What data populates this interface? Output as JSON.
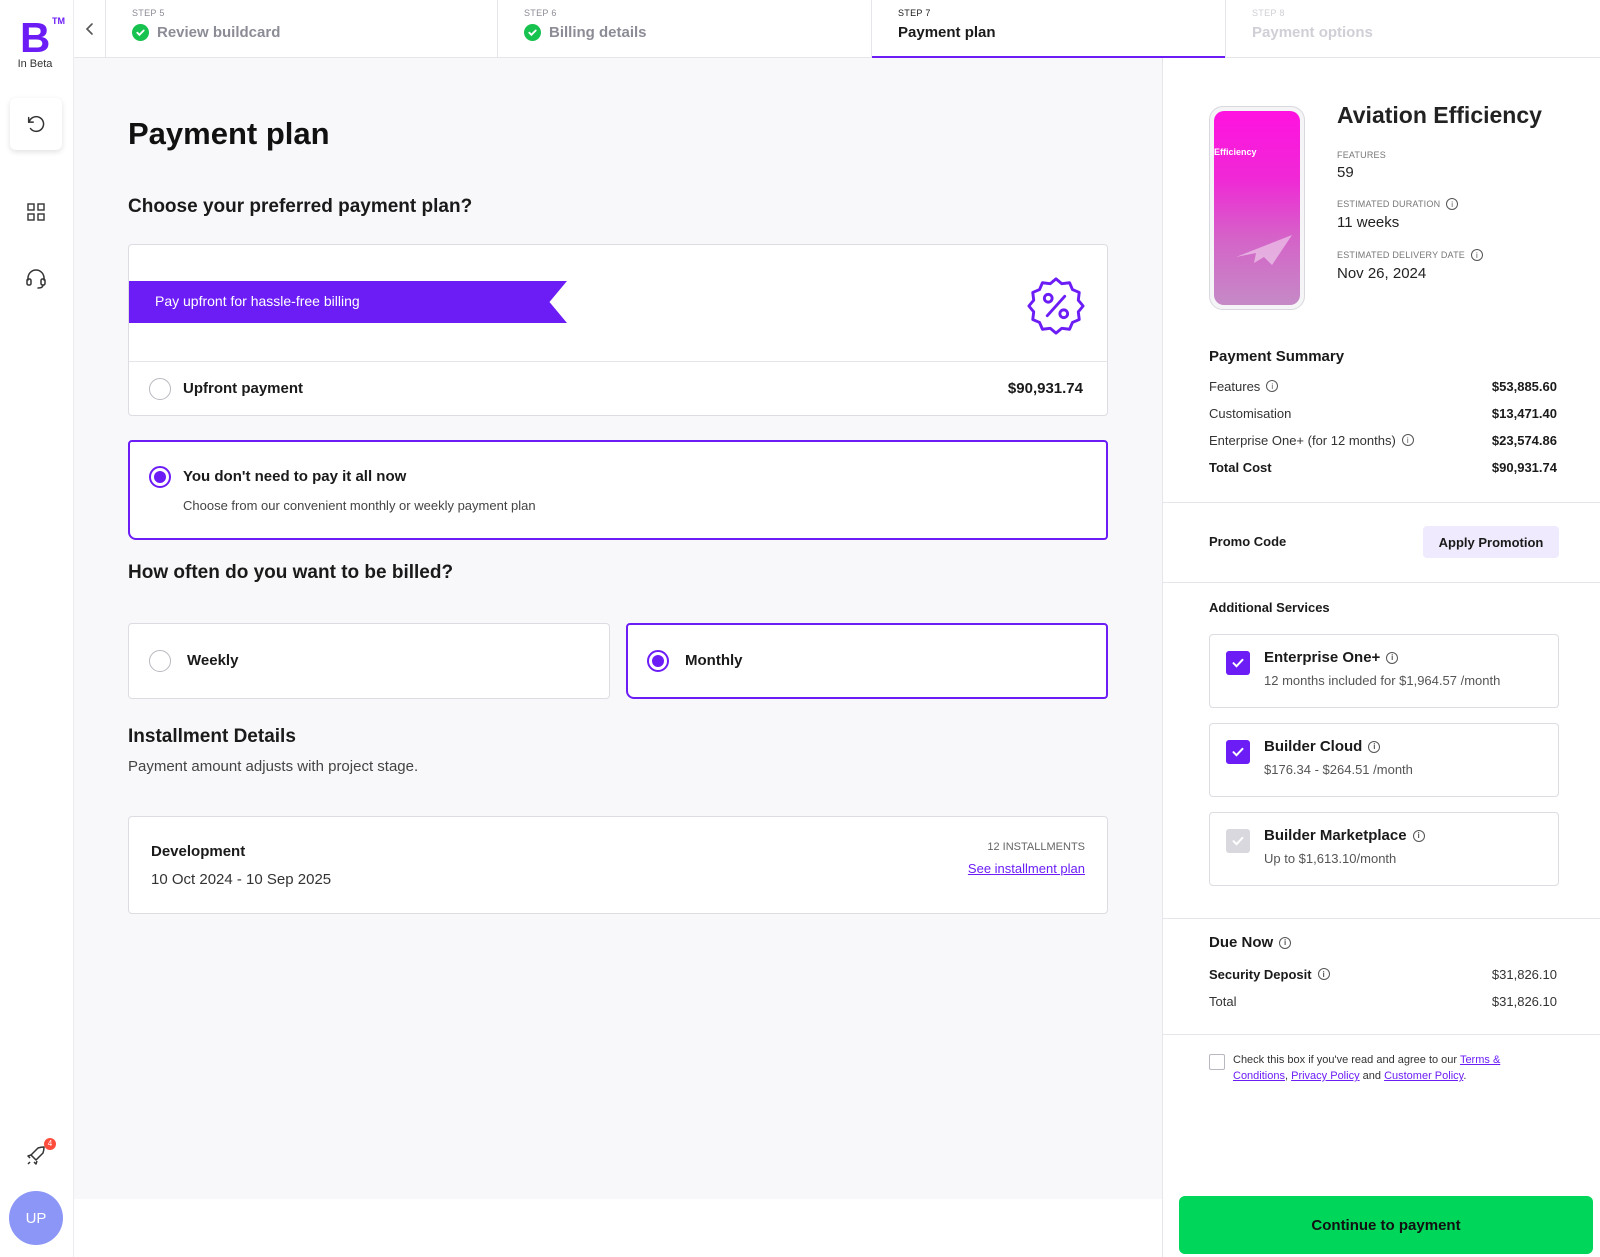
{
  "brand": {
    "logo_letter": "B",
    "logo_tm": "TM",
    "beta": "In Beta",
    "accent": "#6c1df6",
    "success": "#18c24f",
    "cta": "#00d65a"
  },
  "rail": {
    "notification_count": "4",
    "avatar_initials": "UP"
  },
  "steps": [
    {
      "num": "STEP 5",
      "label": "Review buildcard",
      "state": "done"
    },
    {
      "num": "STEP 6",
      "label": "Billing details",
      "state": "done"
    },
    {
      "num": "STEP 7",
      "label": "Payment plan",
      "state": "active"
    },
    {
      "num": "STEP 8",
      "label": "Payment options",
      "state": "future"
    }
  ],
  "main": {
    "title": "Payment plan",
    "plan_question": "Choose your preferred payment plan?",
    "ribbon": "Pay upfront for hassle-free billing",
    "upfront": {
      "label": "Upfront payment",
      "amount": "$90,931.74",
      "selected": false
    },
    "installment_option": {
      "label": "You don't need to pay it all now",
      "sub": "Choose from our convenient monthly or weekly payment plan",
      "selected": true
    },
    "billing_question": "How often do you want to be billed?",
    "frequency": [
      {
        "label": "Weekly",
        "selected": false
      },
      {
        "label": "Monthly",
        "selected": true
      }
    ],
    "installment_title": "Installment Details",
    "installment_sub": "Payment amount adjusts with project stage.",
    "development": {
      "label": "Development",
      "dates": "10 Oct 2024 - 10 Sep 2025",
      "count": "12 INSTALLMENTS",
      "link": "See installment plan"
    }
  },
  "summary": {
    "phone_text": "Efficiency",
    "app_name": "Aviation Efficiency",
    "features_label": "FEATURES",
    "features_value": "59",
    "duration_label": "ESTIMATED DURATION",
    "duration_value": "11 weeks",
    "delivery_label": "ESTIMATED DELIVERY DATE",
    "delivery_value": "Nov 26, 2024",
    "payment_summary_title": "Payment Summary",
    "rows": [
      {
        "label": "Features",
        "value": "$53,885.60",
        "info": true
      },
      {
        "label": "Customisation",
        "value": "$13,471.40",
        "info": false
      },
      {
        "label": "Enterprise One+ (for 12 months)",
        "value": "$23,574.86",
        "info": true
      },
      {
        "label": "Total Cost",
        "value": "$90,931.74",
        "info": false
      }
    ],
    "promo_label": "Promo Code",
    "promo_button": "Apply Promotion",
    "additional_title": "Additional Services",
    "services": [
      {
        "title": "Enterprise One+",
        "sub": "12 months included for $1,964.57 /month",
        "checked": true
      },
      {
        "title": "Builder Cloud",
        "sub": "$176.34 - $264.51 /month",
        "checked": true
      },
      {
        "title": "Builder Marketplace",
        "sub": "Up to $1,613.10/month",
        "checked": false
      }
    ],
    "due_now_title": "Due Now",
    "security_deposit_label": "Security Deposit",
    "security_deposit_value": "$31,826.10",
    "total_label": "Total",
    "total_value": "$31,826.10",
    "terms_prefix": "Check this box if you've read and agree to our",
    "terms_link": "Terms & Conditions",
    "terms_comma": ",",
    "privacy_link": "Privacy Policy",
    "terms_and": "and",
    "customer_link": "Customer Policy",
    "terms_end": ".",
    "continue_button": "Continue to payment"
  }
}
